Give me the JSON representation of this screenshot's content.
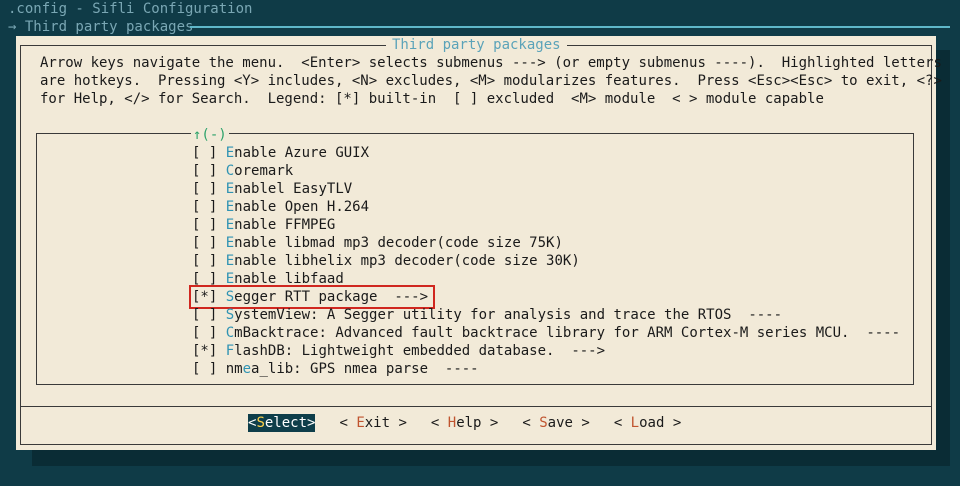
{
  "header": {
    "app_title": ".config - Sifli Configuration",
    "breadcrumb": "→ Third party packages"
  },
  "dialog": {
    "title": "Third party packages",
    "help_lines": [
      "Arrow keys navigate the menu.  <Enter> selects submenus ---> (or empty submenus ----).  Highlighted letters",
      "are hotkeys.  Pressing <Y> includes, <N> excludes, <M> modularizes features.  Press <Esc><Esc> to exit, <?>",
      "for Help, </> for Search.  Legend: [*] built-in  [ ] excluded  <M> module  < > module capable"
    ],
    "scroll_indicator": "↑(-)"
  },
  "menu": {
    "items": [
      {
        "state": "[ ]",
        "hot": "E",
        "label": "nable Azure GUIX"
      },
      {
        "state": "[ ]",
        "hot": "C",
        "label": "oremark"
      },
      {
        "state": "[ ]",
        "hot": "E",
        "label": "nablel EasyTLV"
      },
      {
        "state": "[ ]",
        "hot": "E",
        "label": "nable Open H.264"
      },
      {
        "state": "[ ]",
        "hot": "E",
        "label": "nable FFMPEG"
      },
      {
        "state": "[ ]",
        "hot": "E",
        "label": "nable libmad mp3 decoder(code size 75K)"
      },
      {
        "state": "[ ]",
        "hot": "E",
        "label": "nable libhelix mp3 decoder(code size 30K)"
      },
      {
        "state": "[ ]",
        "hot": "E",
        "label": "nable libfaad"
      },
      {
        "state": "[*]",
        "hot": "S",
        "label": "egger RTT package  --->",
        "selected": true
      },
      {
        "state": "[ ]",
        "hot": "S",
        "label": "ystemView: A Segger utility for analysis and trace the RTOS  ----"
      },
      {
        "state": "[ ]",
        "hot": "C",
        "label": "mBacktrace: Advanced fault backtrace library for ARM Cortex-M series MCU.  ----"
      },
      {
        "state": "[*]",
        "hot": "F",
        "label": "lashDB: Lightweight embedded database.  --->"
      },
      {
        "state": "[ ]",
        "prefix": "nm",
        "hot": "e",
        "label": "a_lib: GPS nmea parse  ----"
      }
    ]
  },
  "buttons": [
    {
      "pre": "<",
      "hot": "S",
      "post": "elect>",
      "active": true
    },
    {
      "pre": "< ",
      "hot": "E",
      "post": "xit >"
    },
    {
      "pre": "< ",
      "hot": "H",
      "post": "elp >"
    },
    {
      "pre": "< ",
      "hot": "S",
      "post": "ave >"
    },
    {
      "pre": "< ",
      "hot": "L",
      "post": "oad >"
    }
  ]
}
